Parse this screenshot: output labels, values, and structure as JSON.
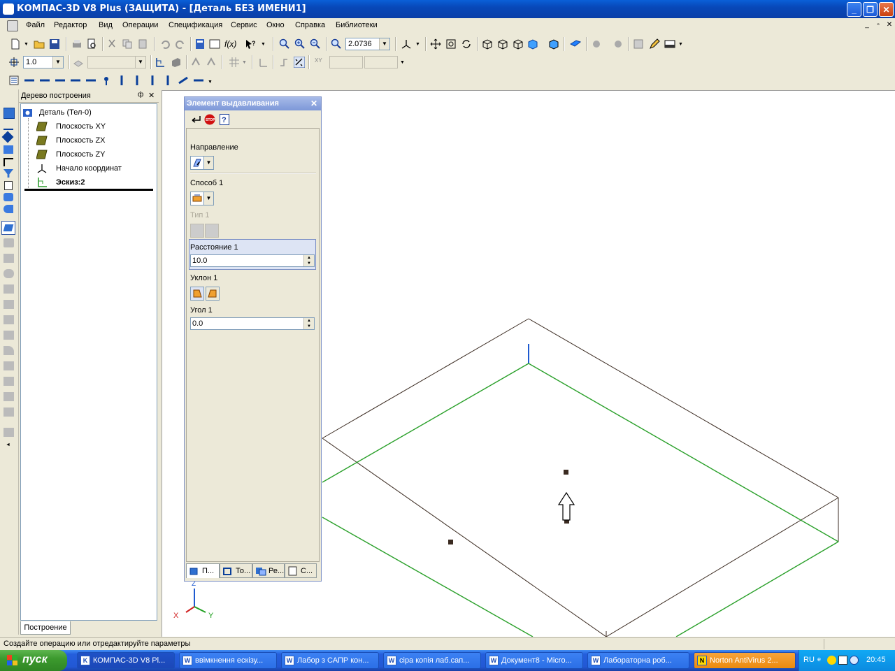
{
  "window": {
    "title": "КОМПАС-3D V8 Plus (ЗАЩИТА) - [Деталь БЕЗ ИМЕНИ1]"
  },
  "menu": [
    "Файл",
    "Редактор",
    "Вид",
    "Операции",
    "Спецификация",
    "Сервис",
    "Окно",
    "Справка",
    "Библиотеки"
  ],
  "toolbar": {
    "zoom": "2.0736",
    "step": "1.0"
  },
  "tree": {
    "title": "Дерево построения",
    "root": "Деталь (Тел-0)",
    "items": [
      "Плоскость XY",
      "Плоскость ZX",
      "Плоскость ZY",
      "Начало координат",
      "Эскиз:2"
    ],
    "bottom_tab": "Построение"
  },
  "dialog": {
    "title": "Элемент выдавливания",
    "direction_label": "Направление",
    "method_label": "Способ 1",
    "type_label": "Тип 1",
    "distance_label": "Расстояние 1",
    "distance_value": "10.0",
    "draft_label": "Уклон 1",
    "angle_label": "Угол 1",
    "angle_value": "0.0",
    "tabs": [
      "П...",
      "То...",
      "Ре...",
      "С..."
    ]
  },
  "status": {
    "text": "Создайте операцию или отредактируйте параметры"
  },
  "axes": {
    "x": "X",
    "y": "Y",
    "z": "Z"
  },
  "taskbar": {
    "start": "пуск",
    "tasks": [
      "КОМПАС-3D V8 Pl...",
      "ввімкнення ескізу...",
      "Лабор з САПР кон...",
      "сіра копія лаб.сап...",
      "Документ8 - Micro...",
      "Лабораторна роб...",
      "Norton AntiVirus 2..."
    ],
    "lang": "RU",
    "clock": "20:45"
  },
  "colors": {
    "sketch_green": "#2aa02a",
    "edge_dark": "#3a2a20",
    "titlebar": "#0a4fc0"
  }
}
